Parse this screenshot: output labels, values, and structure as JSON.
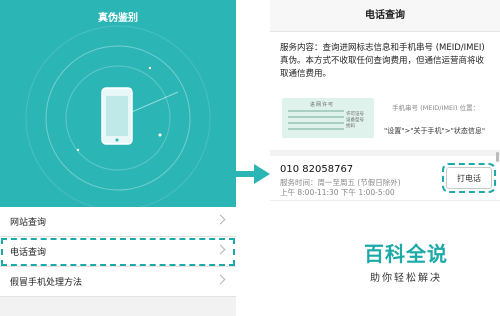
{
  "left": {
    "title": "真伪鉴别",
    "menu": [
      {
        "label": "网站查询"
      },
      {
        "label": "电话查询"
      },
      {
        "label": "假冒手机处理方法"
      }
    ]
  },
  "right": {
    "title": "电话查询",
    "description": "服务内容：查询进网标志信息和手机串号 (MEID/IMEI) 真伪。本方式不收取任何查询费用，但通信运营商将收取通信费用。",
    "imei_card": {
      "license_text": "进网许可",
      "tags": [
        "许可证号",
        "设备型号",
        "扰码"
      ]
    },
    "imei_location_label": "手机串号 (MEID/IMEI) 位置：",
    "imei_path": "\"设置\">\"关于手机\">\"状态信息\"",
    "phone_number": "010 82058767",
    "service_hours_line1": "服务时间：周一至周五 (节假日除外)",
    "service_hours_line2": "上午 8:00-11:30 下午 1:00-5:00",
    "call_button": "打电话"
  },
  "watermark": {
    "main": "百科全说",
    "sub": "助你轻松解决"
  },
  "colors": {
    "teal": "#2bb5b5",
    "highlight": "#1ea9a9"
  }
}
